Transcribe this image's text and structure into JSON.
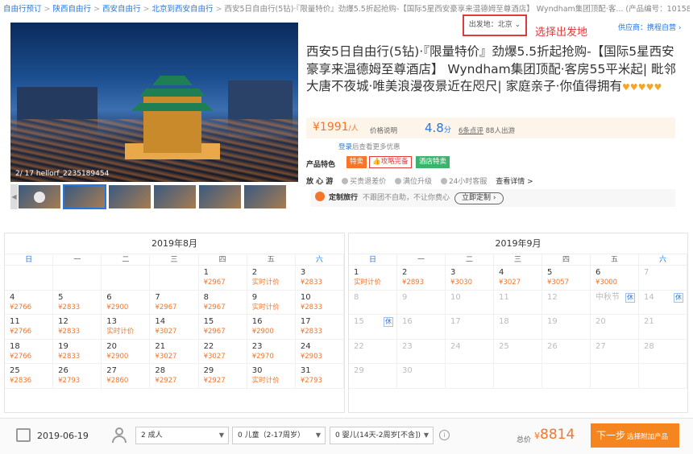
{
  "breadcrumb": {
    "items": [
      "自由行预订",
      "陕西自由行",
      "西安自由行",
      "北京到西安自由行"
    ],
    "current": "西安5日自由行(5钻)·『限量特价』劲爆5.5折起抢购-【国际5星西安豪享来温德姆至尊酒店】 Wyndham集团顶配·客... (产品编号：1015810696)"
  },
  "departure": {
    "label": "出发地：北京"
  },
  "annotation": "选择出发地",
  "supplier": "供应商：携程自营",
  "gallery": {
    "caption": "2/ 17 hellorf_2235189454"
  },
  "product": {
    "title": "西安5日自由行(5钻)·『限量特价』劲爆5.5折起抢购-【国际5星西安豪享来温德姆至尊酒店】 Wyndham集团顶配·客房55平米起| 毗邻大唐不夜城·唯美浪漫夜景近在咫尺| 家庭亲子·你值得拥有",
    "hearts": "♥♥♥♥♥",
    "price": "¥1991",
    "price_unit": "/人",
    "price_explain": "价格说明",
    "score": "4.8",
    "score_unit": "分",
    "review_count": "6条点评",
    "traveled": "88人出游",
    "login_link": "登录",
    "login_text": "后查看更多优惠"
  },
  "features": {
    "label": "产品特色",
    "tags": [
      "特卖",
      "攻略完备",
      "酒店特卖"
    ]
  },
  "worry_free": {
    "label": "放 心 游",
    "items": [
      "买贵退差价",
      "满位升级",
      "24小时客服"
    ],
    "more": "查看详情 >"
  },
  "custom_travel": {
    "label": "定制旅行",
    "desc": "不跟团不自助，不让你费心",
    "button": "立即定制 ›"
  },
  "calendar": {
    "weekdays": [
      "日",
      "一",
      "二",
      "三",
      "四",
      "五",
      "六"
    ],
    "months": [
      {
        "title": "2019年8月",
        "cells": [
          {
            "d": "",
            "p": ""
          },
          {
            "d": "",
            "p": ""
          },
          {
            "d": "",
            "p": ""
          },
          {
            "d": "",
            "p": ""
          },
          {
            "d": "1",
            "p": "¥2967"
          },
          {
            "d": "2",
            "p": "实时计价"
          },
          {
            "d": "3",
            "p": "¥2833"
          },
          {
            "d": "4",
            "p": "¥2766"
          },
          {
            "d": "5",
            "p": "¥2833"
          },
          {
            "d": "6",
            "p": "¥2900"
          },
          {
            "d": "7",
            "p": "¥2967"
          },
          {
            "d": "8",
            "p": "¥2967"
          },
          {
            "d": "9",
            "p": "实时计价"
          },
          {
            "d": "10",
            "p": "¥2833"
          },
          {
            "d": "11",
            "p": "¥2766"
          },
          {
            "d": "12",
            "p": "¥2833"
          },
          {
            "d": "13",
            "p": "实时计价"
          },
          {
            "d": "14",
            "p": "¥3027"
          },
          {
            "d": "15",
            "p": "¥2967"
          },
          {
            "d": "16",
            "p": "¥2900"
          },
          {
            "d": "17",
            "p": "¥2833"
          },
          {
            "d": "18",
            "p": "¥2766"
          },
          {
            "d": "19",
            "p": "¥2833"
          },
          {
            "d": "20",
            "p": "¥2900"
          },
          {
            "d": "21",
            "p": "¥3027"
          },
          {
            "d": "22",
            "p": "¥3027"
          },
          {
            "d": "23",
            "p": "¥2970"
          },
          {
            "d": "24",
            "p": "¥2903"
          },
          {
            "d": "25",
            "p": "¥2836"
          },
          {
            "d": "26",
            "p": "¥2793"
          },
          {
            "d": "27",
            "p": "¥2860"
          },
          {
            "d": "28",
            "p": "¥2927"
          },
          {
            "d": "29",
            "p": "¥2927"
          },
          {
            "d": "30",
            "p": "实时计价"
          },
          {
            "d": "31",
            "p": "¥2793"
          }
        ]
      },
      {
        "title": "2019年9月",
        "cells": [
          {
            "d": "1",
            "p": "实时计价"
          },
          {
            "d": "2",
            "p": "¥2893"
          },
          {
            "d": "3",
            "p": "¥3030"
          },
          {
            "d": "4",
            "p": "¥3027"
          },
          {
            "d": "5",
            "p": "¥3057"
          },
          {
            "d": "6",
            "p": "¥3000"
          },
          {
            "d": "7",
            "p": "",
            "dis": true
          },
          {
            "d": "8",
            "p": "",
            "dis": true
          },
          {
            "d": "9",
            "p": "",
            "dis": true
          },
          {
            "d": "10",
            "p": "",
            "dis": true
          },
          {
            "d": "11",
            "p": "",
            "dis": true
          },
          {
            "d": "12",
            "p": "",
            "dis": true
          },
          {
            "d": "中秋节",
            "p": "",
            "dis": true,
            "hol": "休"
          },
          {
            "d": "14",
            "p": "",
            "dis": true,
            "hol": "休"
          },
          {
            "d": "15",
            "p": "",
            "dis": true,
            "hol": "休"
          },
          {
            "d": "16",
            "p": "",
            "dis": true
          },
          {
            "d": "17",
            "p": "",
            "dis": true
          },
          {
            "d": "18",
            "p": "",
            "dis": true
          },
          {
            "d": "19",
            "p": "",
            "dis": true
          },
          {
            "d": "20",
            "p": "",
            "dis": true
          },
          {
            "d": "21",
            "p": "",
            "dis": true
          },
          {
            "d": "22",
            "p": "",
            "dis": true
          },
          {
            "d": "23",
            "p": "",
            "dis": true
          },
          {
            "d": "24",
            "p": "",
            "dis": true
          },
          {
            "d": "25",
            "p": "",
            "dis": true
          },
          {
            "d": "26",
            "p": "",
            "dis": true
          },
          {
            "d": "27",
            "p": "",
            "dis": true
          },
          {
            "d": "28",
            "p": "",
            "dis": true
          },
          {
            "d": "29",
            "p": "",
            "dis": true
          },
          {
            "d": "30",
            "p": "",
            "dis": true
          },
          {
            "d": "",
            "p": ""
          },
          {
            "d": "",
            "p": ""
          },
          {
            "d": "",
            "p": ""
          },
          {
            "d": "",
            "p": ""
          },
          {
            "d": "",
            "p": ""
          }
        ]
      }
    ]
  },
  "footer": {
    "date": "2019-06-19",
    "adults": "2  成人",
    "children": "0  儿童（2-17周岁）",
    "infants": "0  婴儿(14天-2周岁[不含])",
    "total_label": "总价",
    "total_yen": "¥",
    "total": "8814",
    "next_label": "下一步",
    "next_sub": "选择附加产品"
  }
}
